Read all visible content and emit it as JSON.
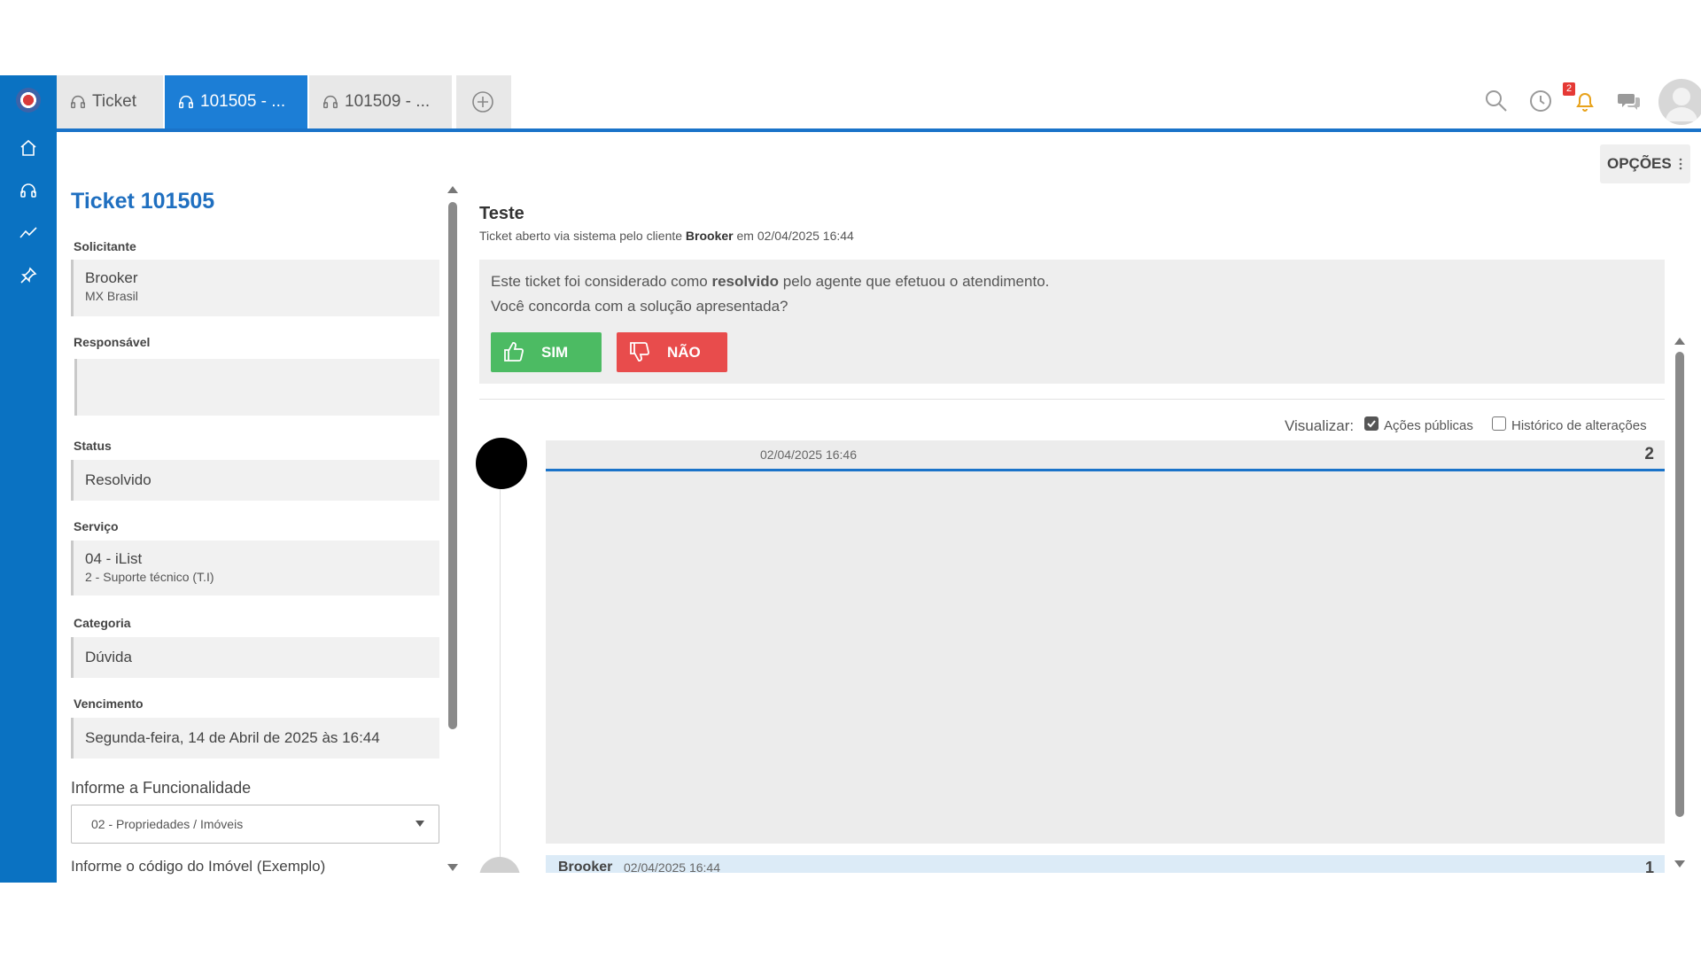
{
  "tabs": [
    {
      "label": "Ticket",
      "icon": "headset-icon"
    },
    {
      "label": "101505 - ...",
      "icon": "headset-icon"
    },
    {
      "label": "101509 - ...",
      "icon": "headset-icon"
    }
  ],
  "notifications": {
    "count": "2"
  },
  "options_label": "OPÇÕES",
  "ticket": {
    "title": "Ticket 101505",
    "fields": {
      "solicitante_label": "Solicitante",
      "solicitante_name": "Brooker",
      "solicitante_org": "MX Brasil",
      "responsavel_label": "Responsável",
      "status_label": "Status",
      "status_value": "Resolvido",
      "servico_label": "Serviço",
      "servico_value": "04 - iList",
      "servico_sub": "2 - Suporte técnico (T.I)",
      "categoria_label": "Categoria",
      "categoria_value": "Dúvida",
      "vencimento_label": "Vencimento",
      "vencimento_value": "Segunda-feira, 14 de Abril de 2025 às 16:44",
      "funcionalidade_label": "Informe a Funcionalidade",
      "funcionalidade_value": "02 - Propriedades / Imóveis",
      "codigo_label": "Informe o código do Imóvel (Exemplo)"
    }
  },
  "main": {
    "subject": "Teste",
    "opened_prefix": "Ticket aberto via sistema pelo cliente ",
    "opened_client": "Brooker",
    "opened_suffix": " em 02/04/2025 16:44",
    "resolve_pre": "Este ticket foi considerado como ",
    "resolve_bold": "resolvido",
    "resolve_post": " pelo agente que efetuou o atendimento.",
    "resolve_question": "Você concorda com a solução apresentada?",
    "yes_label": "SIM",
    "no_label": "NÃO",
    "visualizar_label": "Visualizar:",
    "public_actions_label": "Ações públicas",
    "public_actions_checked": true,
    "history_label": "Histórico de alterações",
    "history_checked": false
  },
  "timeline": [
    {
      "date": "02/04/2025 16:46",
      "number": "2"
    },
    {
      "author": "Brooker",
      "date": "02/04/2025 16:44",
      "number": "1"
    }
  ]
}
